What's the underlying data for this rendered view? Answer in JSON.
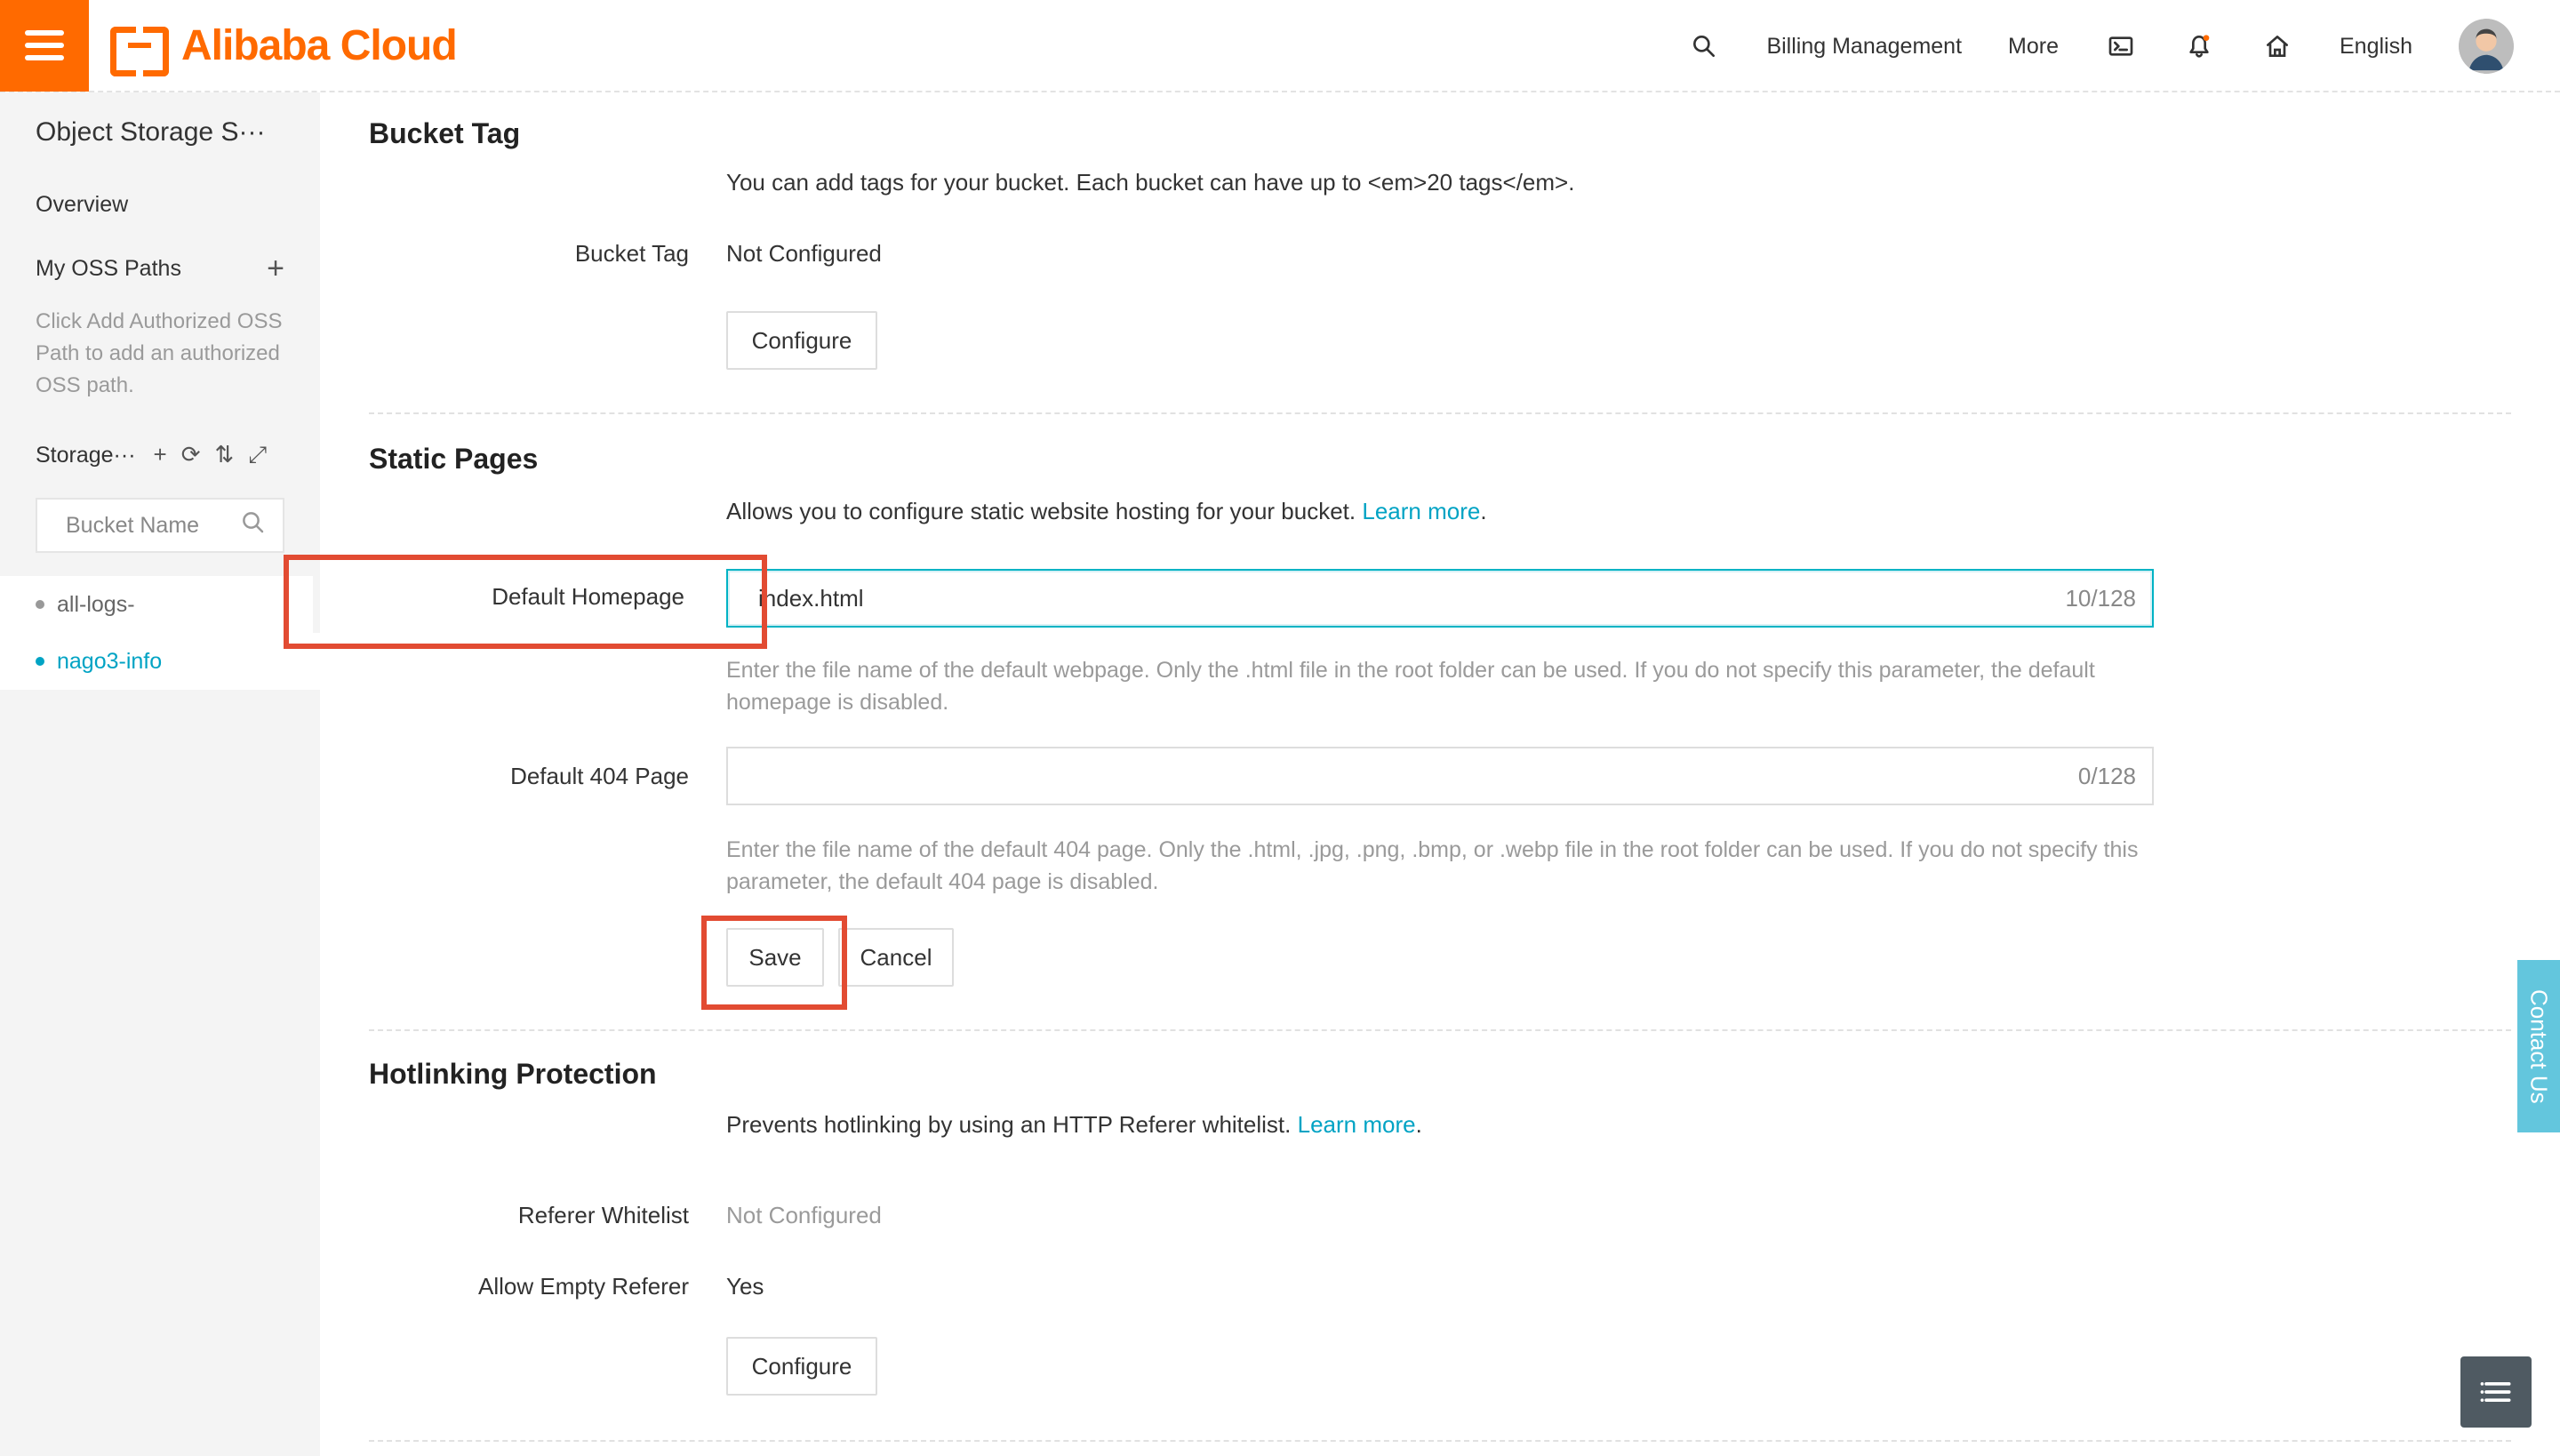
{
  "header": {
    "brand": "Alibaba Cloud",
    "billing_label": "Billing Management",
    "more_label": "More",
    "language_label": "English",
    "icons": [
      "menu-icon",
      "alibaba-logo-icon",
      "search-icon",
      "terminal-icon",
      "bell-icon",
      "home-icon",
      "avatar"
    ],
    "accent": "#ff6a00"
  },
  "sidebar": {
    "title": "Object Storage S···",
    "overview": "Overview",
    "my_oss_paths": "My OSS Paths",
    "note": "Click Add Authorized OSS Path to add an authorized OSS path.",
    "storage_label": "Storage···",
    "search_placeholder": "Bucket Name",
    "buckets": [
      {
        "name": "all-logs-",
        "selected": false
      },
      {
        "name": "nago3-info",
        "selected": true
      }
    ]
  },
  "sections": {
    "bucket_tag": {
      "title": "Bucket Tag",
      "description": "You can add tags for your bucket. Each bucket can have up to <em>20 tags</em>.",
      "row_label": "Bucket Tag",
      "row_value": "Not Configured",
      "configure": "Configure"
    },
    "static_pages": {
      "title": "Static Pages",
      "description": "Allows you to configure static website hosting for your bucket.",
      "learn_more": "Learn more",
      "default_homepage_label": "Default Homepage",
      "default_homepage_value": "index.html",
      "default_homepage_counter": "10/128",
      "homepage_help": "Enter the file name of the default webpage. Only the .html file in the root folder can be used. If you do not specify this parameter, the default homepage is disabled.",
      "default_404_label": "Default 404 Page",
      "default_404_value": "",
      "default_404_counter": "0/128",
      "page404_help": "Enter the file name of the default 404 page. Only the .html, .jpg, .png, .bmp, or .webp file in the root folder can be used. If you do not specify this parameter, the default 404 page is disabled.",
      "save": "Save",
      "cancel": "Cancel"
    },
    "hotlinking": {
      "title": "Hotlinking Protection",
      "description": "Prevents hotlinking by using an HTTP Referer whitelist.",
      "learn_more": "Learn more",
      "referer_whitelist_label": "Referer Whitelist",
      "referer_whitelist_value": "Not Configured",
      "allow_empty_label": "Allow Empty Referer",
      "allow_empty_value": "Yes",
      "configure": "Configure"
    }
  },
  "floating": {
    "contact_us": "Contact Us"
  },
  "colors": {
    "teal": "#00a3c4",
    "highlight": "#e24b32"
  }
}
